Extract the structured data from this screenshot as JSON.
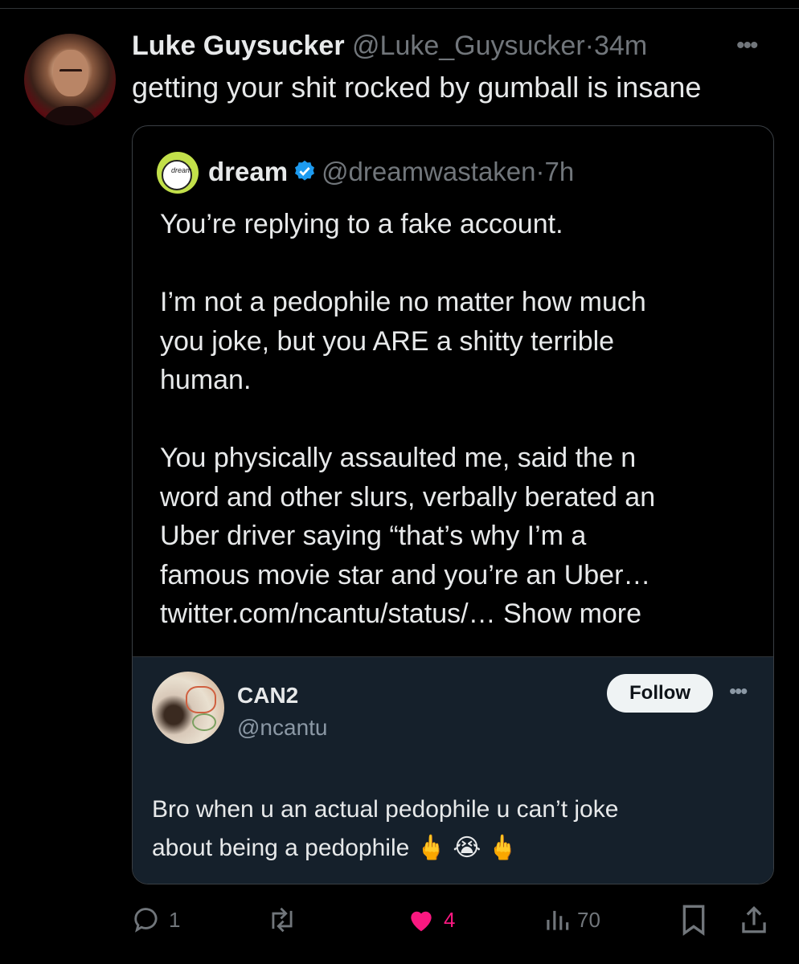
{
  "tweet": {
    "author_name": "Luke Guysucker",
    "author_handle": "@Luke_Guysucker",
    "separator": "·",
    "time": "34m",
    "text": "getting your shit rocked by gumball is insane"
  },
  "quote": {
    "avatar_text": "dream",
    "author_name": "dream",
    "author_handle": "@dreamwastaken",
    "separator": "·",
    "time": "7h",
    "verified_color": "#1d9bf0",
    "para1": "You’re replying to a fake account.",
    "para2_lines": [
      "I’m not a pedophile no matter how much",
      "you joke, but you ARE a shitty terrible",
      "human."
    ],
    "para3_lines": [
      "You physically assaulted me, said the n",
      "word and other slurs, verbally berated an",
      "Uber driver saying “that’s why I’m a",
      "famous movie star and you’re an Uber…"
    ],
    "link_text": "twitter.com/ncantu/status/…",
    "show_more": "Show more"
  },
  "embedded": {
    "name": "CAN2",
    "handle": "@ncantu",
    "follow_label": "Follow",
    "text_line1": "Bro when u an actual pedophile u can’t joke",
    "text_line2": "about being a pedophile",
    "emojis": "🖕 😭 🖕"
  },
  "actions": {
    "reply_count": "1",
    "retweet_count": "",
    "like_count": "4",
    "views_count": "70",
    "like_color": "#f91880"
  }
}
